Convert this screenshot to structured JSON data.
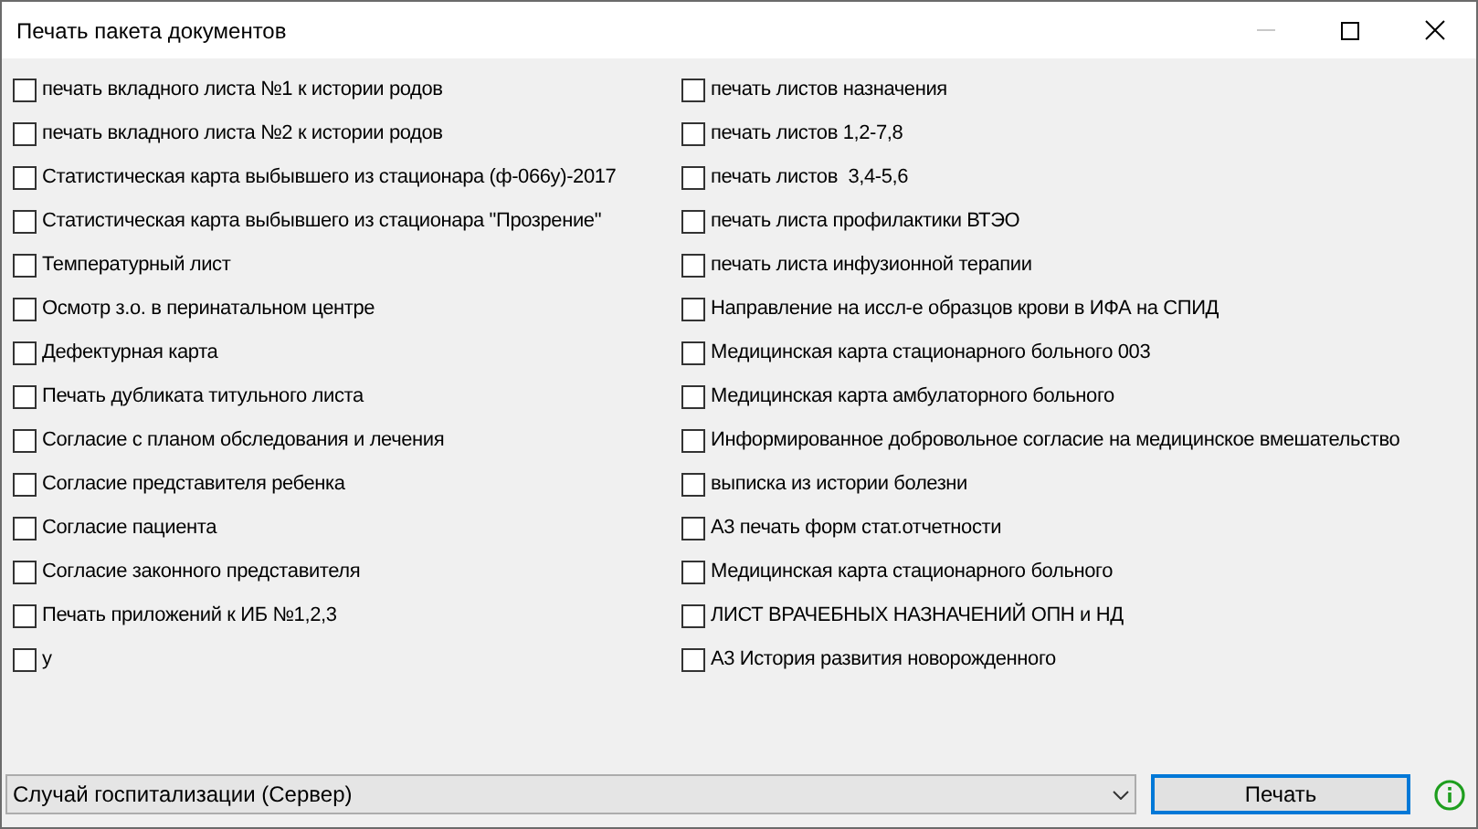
{
  "window": {
    "title": "Печать пакета документов",
    "minimize_disabled": true
  },
  "columns": [
    {
      "items": [
        {
          "label": "печать вкладного листа №1 к истории родов",
          "checked": false
        },
        {
          "label": "печать вкладного листа №2 к истории родов",
          "checked": false
        },
        {
          "label": "Статистическая карта выбывшего из стационара (ф-066у)-2017",
          "checked": false
        },
        {
          "label": "Статистическая карта выбывшего из стационара \"Прозрение\"",
          "checked": false
        },
        {
          "label": "Температурный лист",
          "checked": false
        },
        {
          "label": "Осмотр з.о. в перинатальном центре",
          "checked": false
        },
        {
          "label": "Дефектурная карта",
          "checked": false
        },
        {
          "label": "Печать дубликата титульного листа",
          "checked": false
        },
        {
          "label": "Согласие с планом обследования и лечения",
          "checked": false
        },
        {
          "label": "Согласие представителя ребенка",
          "checked": false
        },
        {
          "label": "Согласие пациента",
          "checked": false
        },
        {
          "label": "Согласие законного представителя",
          "checked": false
        },
        {
          "label": "Печать приложений к ИБ №1,2,3",
          "checked": false
        },
        {
          "label": "у",
          "checked": false
        }
      ]
    },
    {
      "items": [
        {
          "label": "печать листов назначения",
          "checked": false
        },
        {
          "label": "печать листов 1,2-7,8",
          "checked": false
        },
        {
          "label": "печать листов  3,4-5,6",
          "checked": false
        },
        {
          "label": "печать листа профилактики ВТЭО",
          "checked": false
        },
        {
          "label": "печать листа инфузионной терапии",
          "checked": false
        },
        {
          "label": "Направление на иссл-е образцов крови в ИФА на СПИД",
          "checked": false
        },
        {
          "label": "Медицинская карта стационарного больного 003",
          "checked": false
        },
        {
          "label": "Медицинская карта амбулаторного больного",
          "checked": false
        },
        {
          "label": "Информированное добровольное согласие на медицинское вмешательство",
          "checked": false
        },
        {
          "label": "выписка из истории болезни",
          "checked": false
        },
        {
          "label": "А3 печать форм стат.отчетности",
          "checked": false
        },
        {
          "label": "Медицинская карта стационарного больного",
          "checked": false
        },
        {
          "label": "ЛИСТ ВРАЧЕБНЫХ НАЗНАЧЕНИЙ ОПН и НД",
          "checked": false
        },
        {
          "label": "А3 История развития новорожденного",
          "checked": false
        }
      ]
    }
  ],
  "footer": {
    "source_select": "Случай госпитализации (Сервер)",
    "print_button": "Печать"
  }
}
